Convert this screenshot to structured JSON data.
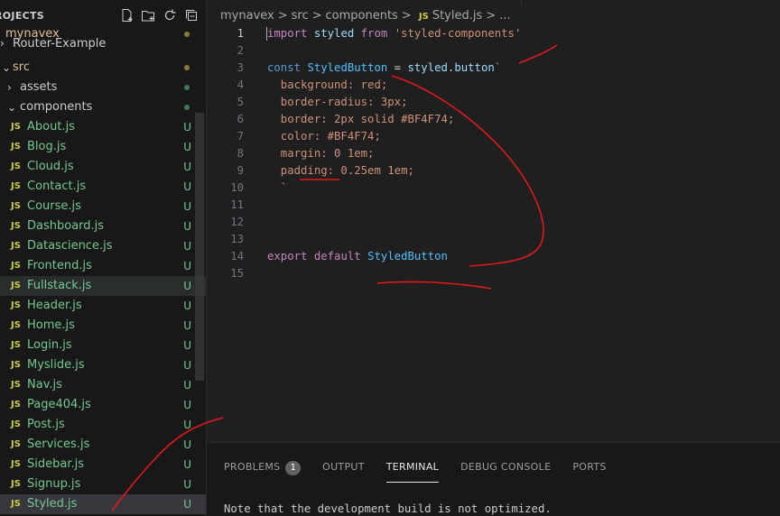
{
  "explorer": {
    "header": "ROJECTS",
    "actions": [
      "new-file-icon",
      "new-folder-icon",
      "refresh-icon",
      "collapse-all-icon"
    ],
    "items": [
      {
        "label": "mynavex",
        "depth": 0,
        "type": "root",
        "color": "orange"
      },
      {
        "label": "Router-Example",
        "depth": 0,
        "type": "folder-closed"
      },
      {
        "label": "src",
        "depth": 0,
        "type": "folder-open",
        "color": "orange"
      },
      {
        "label": "assets",
        "depth": 1,
        "type": "folder-closed"
      },
      {
        "label": "components",
        "depth": 1,
        "type": "folder-open"
      },
      {
        "label": "About.js",
        "status": "U"
      },
      {
        "label": "Blog.js",
        "status": "U"
      },
      {
        "label": "Cloud.js",
        "status": "U"
      },
      {
        "label": "Contact.js",
        "status": "U"
      },
      {
        "label": "Course.js",
        "status": "U"
      },
      {
        "label": "Dashboard.js",
        "status": "U"
      },
      {
        "label": "Datascience.js",
        "status": "U"
      },
      {
        "label": "Frontend.js",
        "status": "U"
      },
      {
        "label": "Fullstack.js",
        "status": "U"
      },
      {
        "label": "Header.js",
        "status": "U"
      },
      {
        "label": "Home.js",
        "status": "U"
      },
      {
        "label": "Login.js",
        "status": "U"
      },
      {
        "label": "Myslide.js",
        "status": "U"
      },
      {
        "label": "Nav.js",
        "status": "U"
      },
      {
        "label": "Page404.js",
        "status": "U"
      },
      {
        "label": "Post.js",
        "status": "U"
      },
      {
        "label": "Services.js",
        "status": "U"
      },
      {
        "label": "Sidebar.js",
        "status": "U"
      },
      {
        "label": "Signup.js",
        "status": "U"
      },
      {
        "label": "Styled.js",
        "status": "U"
      }
    ],
    "file_icon_label": "JS"
  },
  "breadcrumb": {
    "parts": [
      "mynavex",
      ">",
      "src",
      ">",
      "components",
      ">"
    ],
    "file_icon": "JS",
    "file": "Styled.js",
    "tail": "> ..."
  },
  "code": {
    "lines": [
      {
        "n": "1",
        "tokens": [
          [
            "imp",
            "import"
          ],
          [
            "op",
            " "
          ],
          [
            "fn",
            "styled"
          ],
          [
            "op",
            " "
          ],
          [
            "imp",
            "from"
          ],
          [
            "op",
            " "
          ],
          [
            "str",
            "'styled-components'"
          ]
        ]
      },
      {
        "n": "2",
        "tokens": []
      },
      {
        "n": "3",
        "tokens": [
          [
            "kw",
            "const"
          ],
          [
            "op",
            " "
          ],
          [
            "var",
            "StyledButton"
          ],
          [
            "op",
            " = "
          ],
          [
            "fn",
            "styled"
          ],
          [
            "op",
            "."
          ],
          [
            "fn",
            "button"
          ],
          [
            "str",
            "`"
          ]
        ]
      },
      {
        "n": "4",
        "tokens": [
          [
            "cssstr",
            "  background: red;"
          ]
        ]
      },
      {
        "n": "5",
        "tokens": [
          [
            "cssstr",
            "  border-radius: 3px;"
          ]
        ]
      },
      {
        "n": "6",
        "tokens": [
          [
            "cssstr",
            "  border: 2px solid #BF4F74;"
          ]
        ]
      },
      {
        "n": "7",
        "tokens": [
          [
            "cssstr",
            "  color: #BF4F74;"
          ]
        ]
      },
      {
        "n": "8",
        "tokens": [
          [
            "cssstr",
            "  margin: 0 1em;"
          ]
        ]
      },
      {
        "n": "9",
        "tokens": [
          [
            "cssstr",
            "  padding: 0.25em 1em;"
          ]
        ]
      },
      {
        "n": "10",
        "tokens": [
          [
            "cssstr",
            "  `"
          ]
        ]
      },
      {
        "n": "11",
        "tokens": []
      },
      {
        "n": "12",
        "tokens": []
      },
      {
        "n": "13",
        "tokens": []
      },
      {
        "n": "14",
        "tokens": [
          [
            "imp",
            "export"
          ],
          [
            "op",
            " "
          ],
          [
            "imp",
            "default"
          ],
          [
            "op",
            " "
          ],
          [
            "var",
            "StyledButton"
          ]
        ]
      },
      {
        "n": "15",
        "tokens": []
      }
    ]
  },
  "panel": {
    "tabs": [
      "PROBLEMS",
      "OUTPUT",
      "TERMINAL",
      "DEBUG CONSOLE",
      "PORTS"
    ],
    "problems_count": "1",
    "active_tab": "TERMINAL",
    "terminal_text": "Note that the development build is not optimized."
  },
  "colors": {
    "annotation": "#e0191b",
    "untracked": "#73c991",
    "js_icon": "#cbcb41"
  }
}
